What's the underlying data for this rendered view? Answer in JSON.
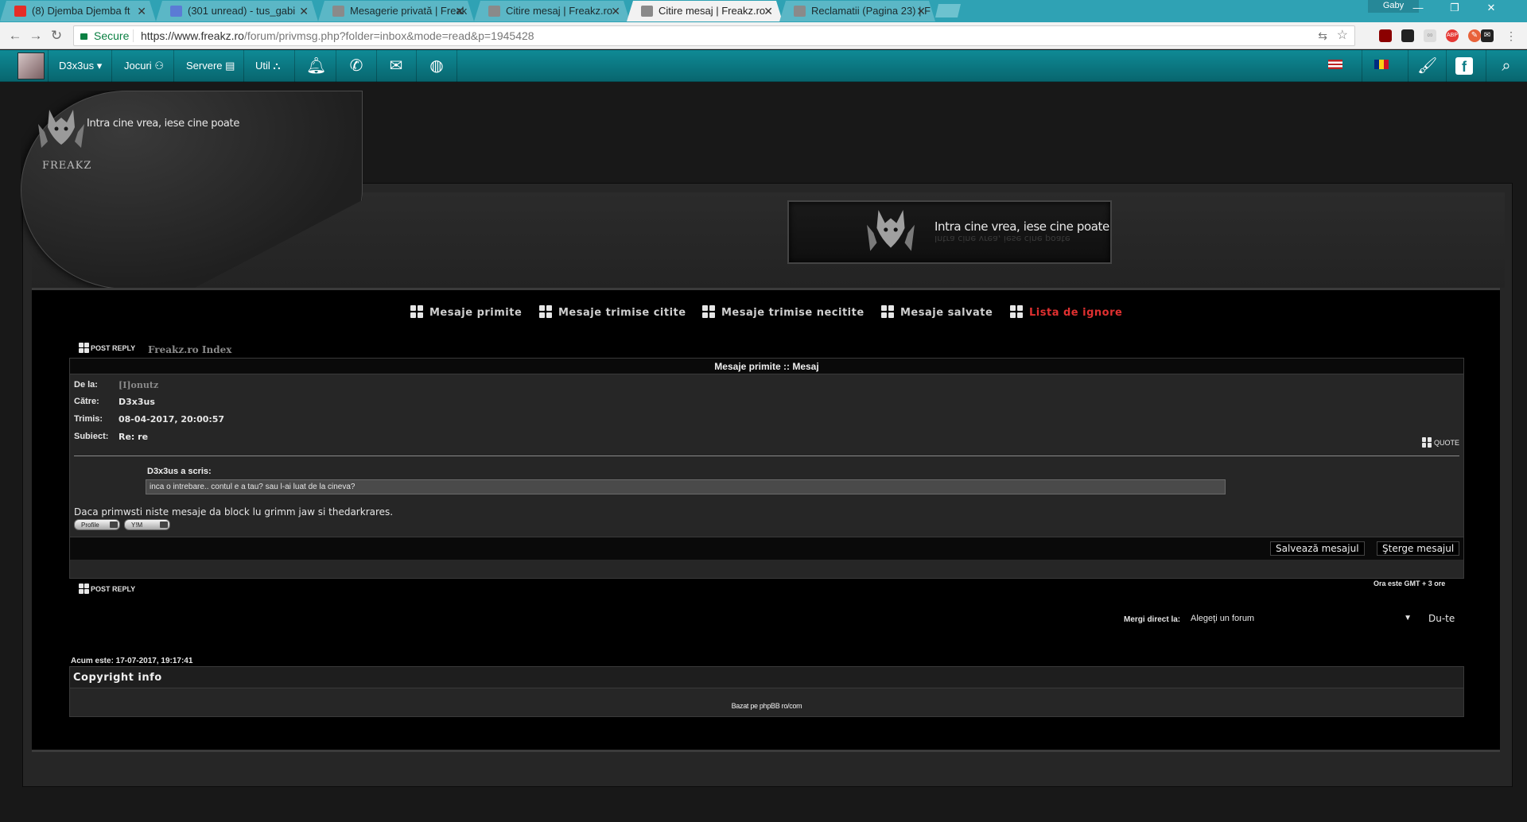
{
  "tabs": [
    {
      "label": "(8) Djemba Djemba ft",
      "fav": "#e52d27",
      "icon": "youtube-icon"
    },
    {
      "label": "(301 unread) - tus_gabi",
      "fav": "#5b7bd5",
      "icon": "mail-icon"
    },
    {
      "label": "Mesagerie privată | Freak",
      "fav": "#8a8a8a",
      "icon": "page-icon"
    },
    {
      "label": "Citire mesaj | Freakz.ro",
      "fav": "#8a8a8a",
      "icon": "page-icon"
    },
    {
      "label": "Citire mesaj | Freakz.ro",
      "fav": "#8a8a8a",
      "icon": "page-icon",
      "active": true
    },
    {
      "label": "Reclamatii (Pagina 23) | F",
      "fav": "#8a8a8a",
      "icon": "page-icon"
    }
  ],
  "window": {
    "user": "Gaby"
  },
  "omnibar": {
    "secure": "Secure",
    "url_host": "https://www.freakz.ro",
    "url_path": "/forum/privmsg.php?folder=inbox&mode=read&p=1945428"
  },
  "sitenav": {
    "user": "D3x3us",
    "jocuri": "Jocuri",
    "servere": "Servere",
    "util": "Util"
  },
  "header": {
    "tagline": "Intra cine vrea, iese cine poate",
    "brand": "FREAKZ"
  },
  "pm_tabs": [
    "Mesaje primite",
    "Mesaje trimise citite",
    "Mesaje trimise necitite",
    "Mesaje salvate",
    "Lista de ignore"
  ],
  "post_reply": "POST REPLY",
  "crumb": "Freakz.ro Index",
  "message": {
    "header": "Mesaje primite :: Mesaj",
    "from_label": "De la:",
    "from": "[I]onutz",
    "to_label": "Către:",
    "to": "D3x3us",
    "sent_label": "Trimis:",
    "sent": "08-04-2017, 20:00:57",
    "subject_label": "Subiect:",
    "subject": "Re: re",
    "quote_btn": "QUOTE",
    "quote_author": "D3x3us a scris:",
    "quote_text": "inca o intrebare.. contul e a tau? sau l-ai luat de la cineva?",
    "body": "Daca primwsti niste mesaje da block lu grimm jaw si thedarkrares.",
    "profile": "Profile",
    "yim": "Y!M",
    "save": "Salvează mesajul",
    "delete": "Şterge mesajul"
  },
  "timezone": "Ora este GMT + 3 ore",
  "jump": {
    "label": "Mergi direct la:",
    "select": "Alegeţi un forum",
    "button": "Du-te"
  },
  "now": "Acum este: 17-07-2017, 19:17:41",
  "copyright": {
    "title": "Copyright info",
    "text": "Bazat pe phpBB ro/com"
  },
  "colors": {
    "accent_nav": "#0f8a96",
    "ignore_link": "#e03030",
    "tabstrip": "#2fa2b4"
  }
}
